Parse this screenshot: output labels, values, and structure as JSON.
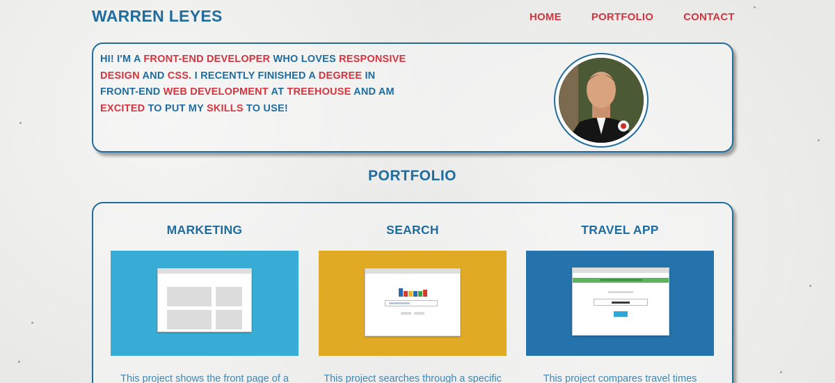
{
  "header": {
    "title": "WARREN LEYES",
    "nav": [
      "HOME",
      "PORTFOLIO",
      "CONTACT"
    ]
  },
  "intro": {
    "segments": [
      {
        "text": "HI! I'M A ",
        "hl": false
      },
      {
        "text": "FRONT-END DEVELOPER",
        "hl": true
      },
      {
        "text": " WHO LOVES ",
        "hl": false
      },
      {
        "text": "RESPONSIVE DESIGN",
        "hl": true
      },
      {
        "text": " AND ",
        "hl": false
      },
      {
        "text": "CSS.",
        "hl": true
      },
      {
        "text": " I RECENTLY FINISHED A ",
        "hl": false
      },
      {
        "text": "DEGREE",
        "hl": true
      },
      {
        "text": " IN FRONT-END ",
        "hl": false
      },
      {
        "text": "WEB DEVELOPMENT",
        "hl": true
      },
      {
        "text": " AT ",
        "hl": false
      },
      {
        "text": "TREEHOUSE",
        "hl": true
      },
      {
        "text": " AND AM ",
        "hl": false
      },
      {
        "text": "EXCITED",
        "hl": true
      },
      {
        "text": " TO PUT MY ",
        "hl": false
      },
      {
        "text": "SKILLS",
        "hl": true
      },
      {
        "text": " TO USE!",
        "hl": false
      }
    ]
  },
  "portfolio": {
    "title": "PORTFOLIO",
    "projects": [
      {
        "title": "MARKETING",
        "desc": "This project shows the front page of a",
        "color": "#37acd4"
      },
      {
        "title": "SEARCH",
        "desc": "This project searches through a specific",
        "color": "#e1aa24"
      },
      {
        "title": "TRAVEL APP",
        "desc": "This project compares travel times",
        "color": "#2473ad"
      }
    ]
  },
  "colors": {
    "primary": "#1f6c9e",
    "accent": "#d2353f"
  }
}
